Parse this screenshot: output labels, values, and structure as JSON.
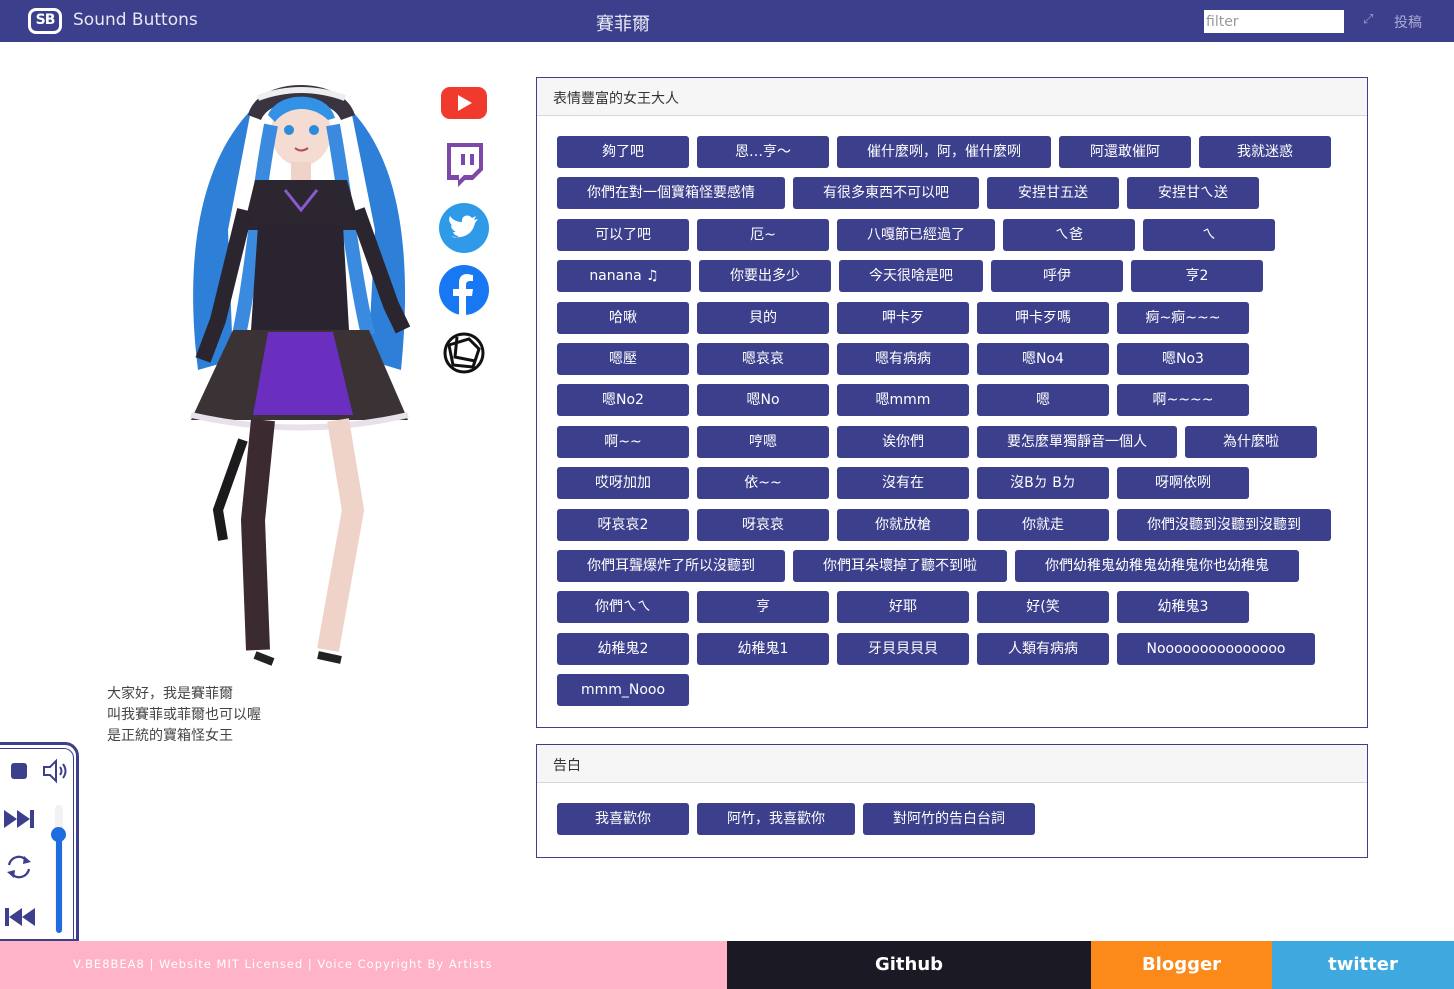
{
  "header": {
    "logo_text": "SB",
    "brand": "Sound Buttons",
    "title": "賽菲爾",
    "filter_placeholder": "filter",
    "expand_icon": "expand-icon",
    "post_label": "投稿"
  },
  "social": [
    "youtube-icon",
    "twitch-icon",
    "twitter-icon",
    "facebook-icon",
    "website-icon"
  ],
  "intro": {
    "line1": "大家好，我是賽菲爾",
    "line2": "叫我賽菲或菲爾也可以喔",
    "line3": "是正統的寶箱怪女王"
  },
  "player": {
    "icons": [
      "stop-icon",
      "volume-icon",
      "next-icon",
      "repeat-icon",
      "previous-icon"
    ],
    "volume": 0.77
  },
  "sections": [
    {
      "title": "表情豐富的女王大人",
      "rows": [
        [
          "夠了吧",
          "恩…亨～",
          "催什麼咧，阿，催什麼咧",
          "阿還敢催阿",
          "我就迷惑"
        ],
        [
          "你們在對一個寶箱怪要感情",
          "有很多東西不可以吧",
          "安捏甘五送",
          "安捏甘ㄟ送"
        ],
        [
          "可以了吧",
          "厄~",
          "八嘎節已經過了",
          "ㄟ爸",
          "ㄟ"
        ],
        [
          "nanana ♫",
          "你要出多少",
          "今天很啥是吧",
          "呼伊",
          "亨2"
        ],
        [
          "哈啾",
          "貝的",
          "呷卡歹",
          "呷卡歹嗎",
          "痾~痾~~~"
        ],
        [
          "嗯壓",
          "嗯哀哀",
          "嗯有病病",
          "嗯No4",
          "嗯No3"
        ],
        [
          "嗯No2",
          "嗯No",
          "嗯mmm",
          "嗯",
          "啊~~~~"
        ],
        [
          "啊~~",
          "哼嗯",
          "诶你們",
          "要怎麼單獨靜音一個人",
          "為什麼啦"
        ],
        [
          "哎呀加加",
          "依~~",
          "沒有在",
          "沒Bㄉ Bㄉ",
          "呀啊依咧"
        ],
        [
          "呀哀哀2",
          "呀哀哀",
          "你就放槍",
          "你就走",
          "你們沒聽到沒聽到沒聽到"
        ],
        [
          "你們耳聾爆炸了所以沒聽到",
          "你們耳朵壞掉了聽不到啦",
          "你們幼稚鬼幼稚鬼幼稚鬼你也幼稚鬼"
        ],
        [
          "你們ㄟㄟ",
          "亨",
          "好耶",
          "好(笑",
          "幼稚鬼3"
        ],
        [
          "幼稚鬼2",
          "幼稚鬼1",
          "牙貝貝貝貝",
          "人類有病病",
          "Nooooooooooooooo"
        ],
        [
          "mmm_Nooo"
        ]
      ]
    },
    {
      "title": "告白",
      "rows": [
        [
          "我喜歡你",
          "阿竹，我喜歡你",
          "對阿竹的告白台詞"
        ]
      ]
    }
  ],
  "footer": {
    "license": "V.BE8BEA8 | Website MIT Licensed | Voice Copyright By Artists",
    "github": "Github",
    "blogger": "Blogger",
    "twitter": "twitter"
  },
  "colors": {
    "primary": "#3c3f8c",
    "footer_pink": "#ffb3c6",
    "github": "#1b1a24",
    "blogger": "#fb8a1a",
    "twitter": "#3ea9df",
    "accent_blue": "#1f6be0"
  }
}
